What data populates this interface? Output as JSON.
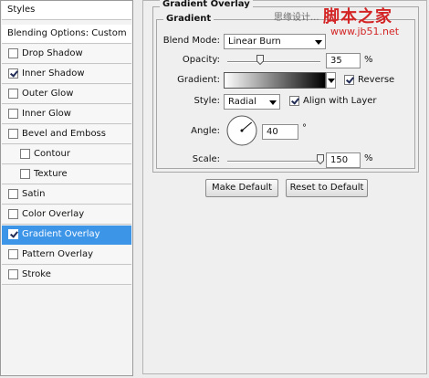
{
  "left_panel": {
    "header": "Styles",
    "blending_options": "Blending Options: Custom",
    "items": [
      {
        "label": "Drop Shadow",
        "checked": false,
        "sub": false
      },
      {
        "label": "Inner Shadow",
        "checked": true,
        "sub": false
      },
      {
        "label": "Outer Glow",
        "checked": false,
        "sub": false
      },
      {
        "label": "Inner Glow",
        "checked": false,
        "sub": false
      },
      {
        "label": "Bevel and Emboss",
        "checked": false,
        "sub": false
      },
      {
        "label": "Contour",
        "checked": false,
        "sub": true
      },
      {
        "label": "Texture",
        "checked": false,
        "sub": true
      },
      {
        "label": "Satin",
        "checked": false,
        "sub": false
      },
      {
        "label": "Color Overlay",
        "checked": false,
        "sub": false
      },
      {
        "label": "Gradient Overlay",
        "checked": true,
        "sub": false,
        "selected": true
      },
      {
        "label": "Pattern Overlay",
        "checked": false,
        "sub": false
      },
      {
        "label": "Stroke",
        "checked": false,
        "sub": false
      }
    ]
  },
  "panel": {
    "title": "Gradient Overlay",
    "group_title": "Gradient",
    "blend_mode_label": "Blend Mode:",
    "blend_mode_value": "Linear Burn",
    "opacity_label": "Opacity:",
    "opacity_value": "35",
    "opacity_unit": "%",
    "opacity_level": 0.35,
    "gradient_label": "Gradient:",
    "reverse_label": "Reverse",
    "reverse_checked": true,
    "style_label": "Style:",
    "style_value": "Radial",
    "align_label": "Align with Layer",
    "align_checked": true,
    "angle_label": "Angle:",
    "angle_value": "40",
    "angle_unit": "°",
    "angle_degrees": 40,
    "scale_label": "Scale:",
    "scale_value": "150",
    "scale_unit": "%",
    "scale_level": 1.0,
    "make_default": "Make Default",
    "reset_default": "Reset to Default"
  },
  "watermark": {
    "small": "思缘设计...",
    "big": "脚本之家",
    "url": "www.jb51.net"
  },
  "colors": {
    "selected_row": "#3d95e8",
    "watermark_red": "#d32525"
  }
}
